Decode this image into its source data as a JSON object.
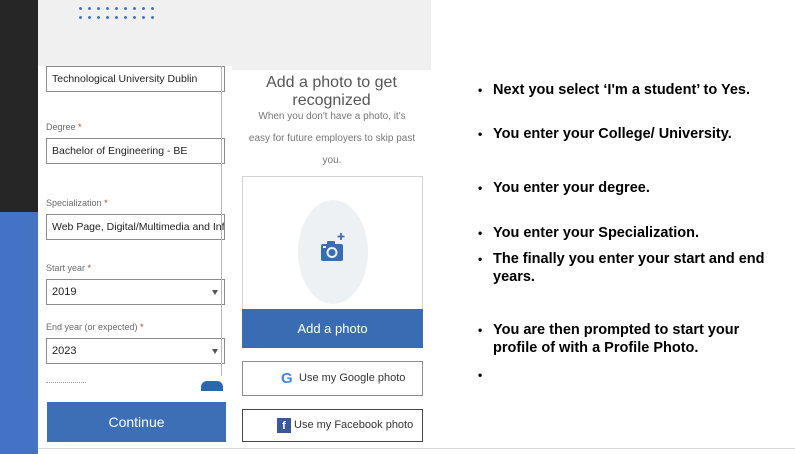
{
  "form": {
    "university_value": "Technological University Dublin",
    "degree_label": "Degree",
    "degree_value": "Bachelor of Engineering - BE",
    "specialization_label": "Specialization",
    "specialization_value": "Web Page, Digital/Multimedia and Informatio",
    "start_year_label": "Start year",
    "start_year_value": "2019",
    "end_year_label": "End year (or expected)",
    "end_year_value": "2023",
    "required_marker": "*",
    "continue_label": "Continue"
  },
  "photo_panel": {
    "title": "Add a photo to get recognized",
    "subtitle": "When you don't have a photo, it's easy for future employers to skip past you.",
    "add_photo_label": "Add a photo",
    "google_label": "Use my Google photo",
    "google_glyph": "G",
    "facebook_label": "Use my Facebook photo",
    "facebook_glyph": "f"
  },
  "bullets": [
    "Next you select ‘I'm a student’ to Yes.",
    "You enter your College/ University.",
    "You enter your degree.",
    "You enter your Specialization.",
    "The finally you enter your start and end years.",
    "You are then prompted to start your profile of with a Profile  Photo.",
    ""
  ],
  "bullet_glyph": "•",
  "colors": {
    "accent_blue": "#4472c4",
    "button_blue": "#3a6cb4",
    "dark_sidebar": "#262626"
  }
}
